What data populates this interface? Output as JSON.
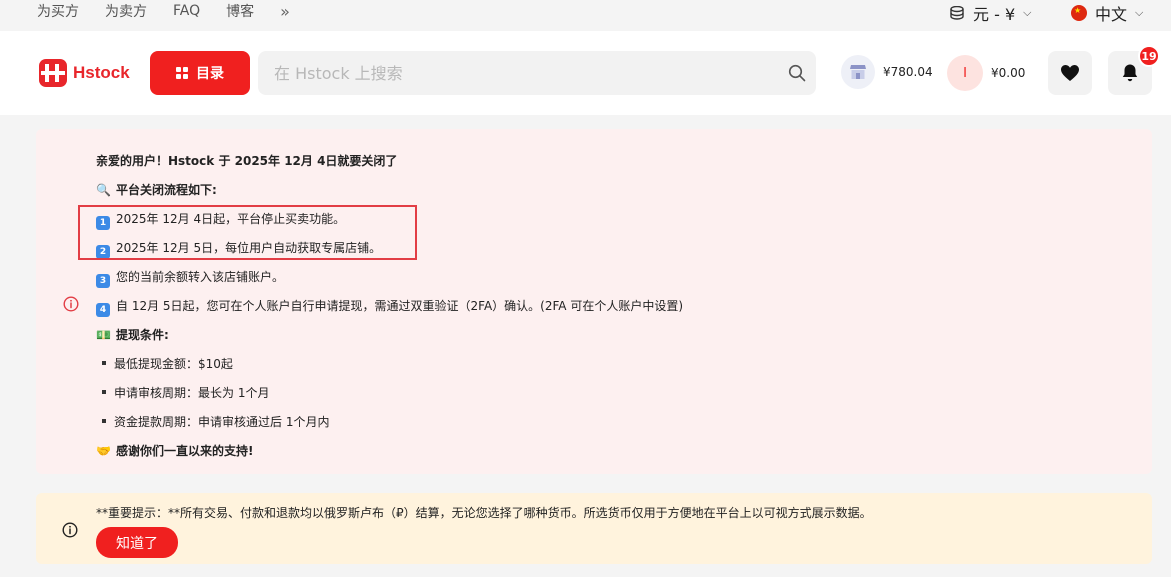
{
  "topbar": {
    "nav": [
      "为买方",
      "为卖方",
      "FAQ",
      "博客"
    ],
    "more": "»",
    "currency": "元 - ¥",
    "language": "中文"
  },
  "header": {
    "logo_text": "Hstock",
    "catalog_label": "目录",
    "search_placeholder": "在 Hstock 上搜索",
    "store_balance": "¥780.04",
    "avatar_letter": "I",
    "user_balance": "¥0.00",
    "notification_count": "19"
  },
  "notice": {
    "greeting": "亲爱的用户！Hstock 于 2025年 12月 4日就要关闭了",
    "process_title": "平台关闭流程如下:",
    "steps": [
      {
        "num": "1",
        "text": "2025年 12月 4日起，平台停止买卖功能。"
      },
      {
        "num": "2",
        "text": "2025年 12月 5日，每位用户自动获取专属店铺。"
      },
      {
        "num": "3",
        "text": "您的当前余额转入该店铺账户。"
      },
      {
        "num": "4",
        "text": "自 12月 5日起，您可在个人账户自行申请提现，需通过双重验证（2FA）确认。(2FA 可在个人账户中设置)"
      }
    ],
    "conditions_title": "提现条件:",
    "conditions": [
      "最低提现金额：$10起",
      "申请审核周期：最长为 1个月",
      "资金提款周期：申请审核通过后 1个月内"
    ],
    "thanks": "感谢你们一直以来的支持!"
  },
  "warning": {
    "text": "**重要提示：**所有交易、付款和退款均以俄罗斯卢布（₽）结算，无论您选择了哪种货币。所选货币仅用于方便地在平台上以可视方式展示数据。",
    "button": "知道了"
  },
  "colors": {
    "brand_red": "#f0201f",
    "notice_bg": "#fdf0f0",
    "warning_bg": "#fff3dd",
    "highlight_border": "#e23d45"
  }
}
